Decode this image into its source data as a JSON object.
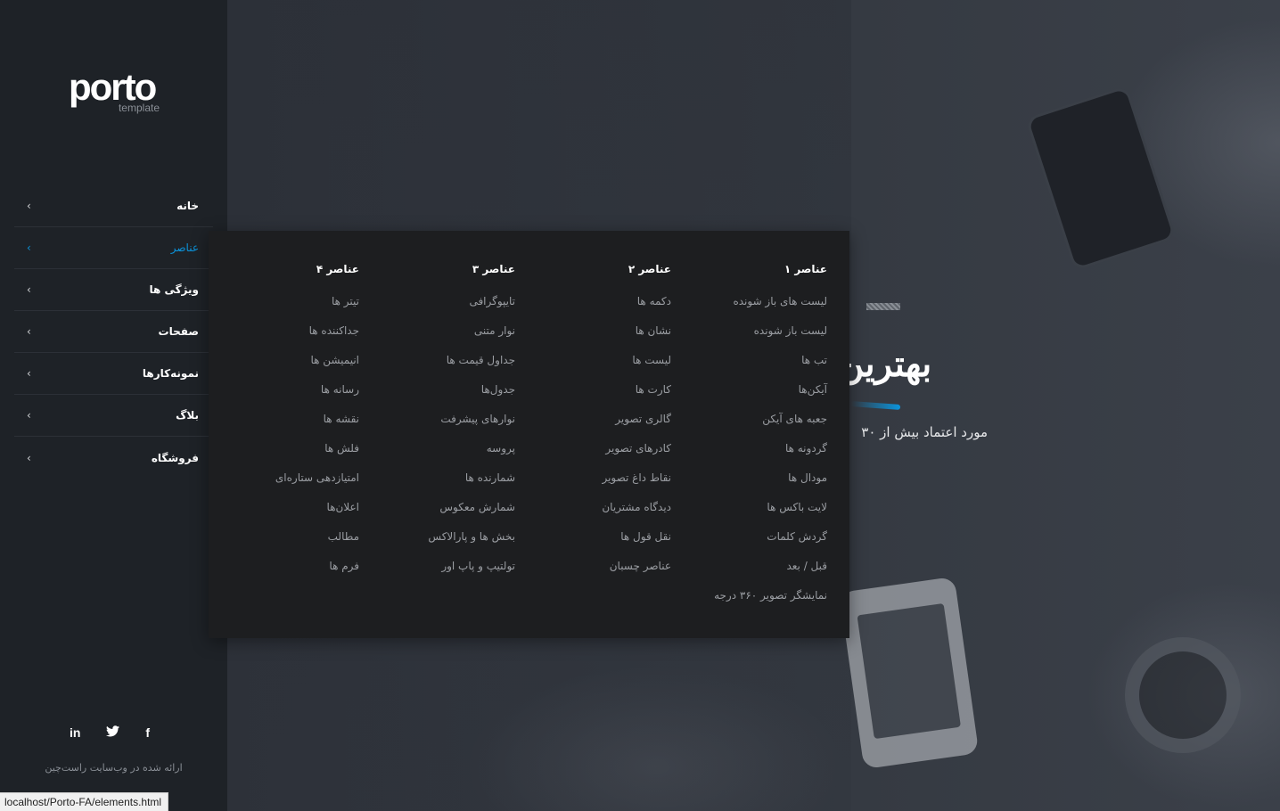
{
  "logo": {
    "main": "porto",
    "sub": "template"
  },
  "nav": {
    "items": [
      {
        "label": "خانه",
        "active": false
      },
      {
        "label": "عناصر",
        "active": true
      },
      {
        "label": "ویژگی ها",
        "active": false
      },
      {
        "label": "صفحات",
        "active": false
      },
      {
        "label": "نمونه‌کارها",
        "active": false
      },
      {
        "label": "بلاگ",
        "active": false
      },
      {
        "label": "فروشگاه",
        "active": false
      }
    ],
    "chevron": "‹"
  },
  "social": {
    "linkedin": "in",
    "twitter": "🐦",
    "facebook": "f"
  },
  "credit": "ارائه شده در وب‌سایت راست‌چین",
  "hero": {
    "title": "بهترین",
    "subtitle": "مورد اعتماد بیش از ۳۰"
  },
  "mega_menu": {
    "columns": [
      {
        "title": "عناصر ۱",
        "items": [
          "لیست های باز شونده",
          "لیست باز شونده",
          "تب ها",
          "آیکن‌ها",
          "جعبه های آیکن",
          "گردونه ها",
          "مودال ها",
          "لایت باکس ها",
          "گردش کلمات",
          "قبل / بعد",
          "نمایشگر تصویر ۳۶۰ درجه"
        ]
      },
      {
        "title": "عناصر ۲",
        "items": [
          "دکمه ها",
          "نشان ها",
          "لیست ها",
          "کارت ها",
          "گالری تصویر",
          "کادرهای تصویر",
          "نقاط داغ تصویر",
          "دیدگاه مشتریان",
          "نقل قول ها",
          "عناصر چسبان"
        ]
      },
      {
        "title": "عناصر ۳",
        "items": [
          "تایپوگرافی",
          "نوار متنی",
          "جداول قیمت ها",
          "جدول‌ها",
          "نوارهای پیشرفت",
          "پروسه",
          "شمارنده ها",
          "شمارش معکوس",
          "بخش ها و پارالاکس",
          "تولتیپ و پاپ اور"
        ]
      },
      {
        "title": "عناصر ۴",
        "items": [
          "تیتر ها",
          "جداکننده ها",
          "انیمیشن ها",
          "رسانه ها",
          "نقشه ها",
          "فلش ها",
          "امتیازدهی ستاره‌ای",
          "اعلان‌ها",
          "مطالب",
          "فرم ها"
        ]
      }
    ]
  },
  "statusbar": {
    "url": "localhost/Porto-FA/elements.html"
  },
  "colors": {
    "accent": "#0b94dc",
    "sidebar": "#1e2227",
    "menu": "#1d1e20"
  }
}
